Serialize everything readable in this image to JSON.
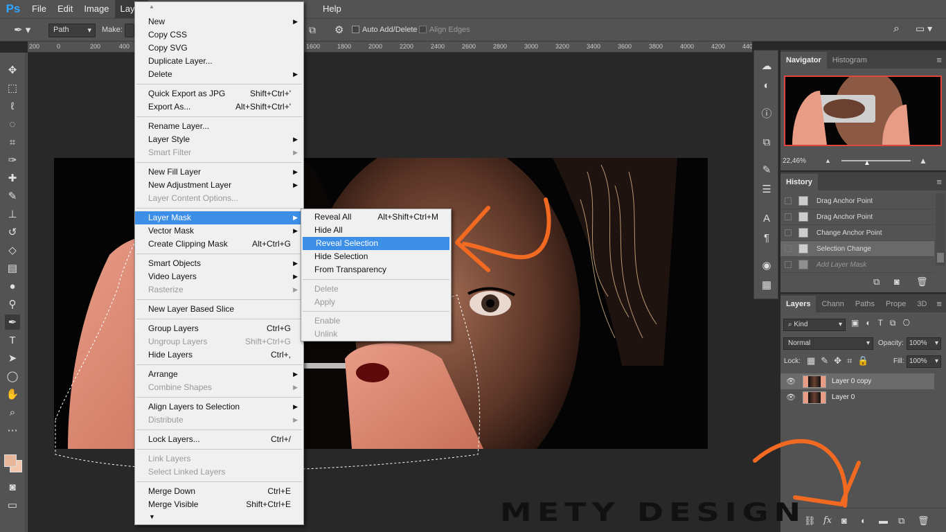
{
  "app": {
    "logo": "Ps"
  },
  "menubar": {
    "items": [
      {
        "label": "File"
      },
      {
        "label": "Edit"
      },
      {
        "label": "Image"
      },
      {
        "label": "Layer"
      },
      {
        "label": "Help"
      }
    ]
  },
  "options": {
    "mode": "Path",
    "make_label": "Make:",
    "auto_add_delete": "Auto Add/Delete",
    "align_edges": "Align Edges"
  },
  "ruler": {
    "ticks": [
      "200",
      "0",
      "200",
      "400",
      "1600",
      "1800",
      "2000",
      "2200",
      "2400",
      "2600",
      "2800",
      "3000",
      "3200",
      "3400",
      "3600",
      "3800",
      "4000",
      "4200",
      "440"
    ]
  },
  "toolbar": {
    "icons": [
      "move-icon",
      "marquee-icon",
      "lasso-icon",
      "quick-select-icon",
      "crop-icon",
      "eyedropper-icon",
      "healing-icon",
      "brush-icon",
      "stamp-icon",
      "history-brush-icon",
      "eraser-icon",
      "gradient-icon",
      "blur-icon",
      "dodge-icon",
      "pen-icon",
      "type-icon",
      "path-select-icon",
      "ellipse-icon",
      "hand-icon",
      "zoom-icon",
      "more-icon"
    ]
  },
  "layer_menu": {
    "items": [
      {
        "label": "New",
        "arrow": true
      },
      {
        "label": "Copy CSS"
      },
      {
        "label": "Copy SVG"
      },
      {
        "label": "Duplicate Layer..."
      },
      {
        "label": "Delete",
        "arrow": true
      },
      {
        "label": "Quick Export as JPG",
        "shortcut": "Shift+Ctrl+'"
      },
      {
        "label": "Export As...",
        "shortcut": "Alt+Shift+Ctrl+'"
      },
      {
        "label": "Rename Layer..."
      },
      {
        "label": "Layer Style",
        "arrow": true
      },
      {
        "label": "Smart Filter",
        "arrow": true,
        "disabled": true
      },
      {
        "label": "New Fill Layer",
        "arrow": true
      },
      {
        "label": "New Adjustment Layer",
        "arrow": true
      },
      {
        "label": "Layer Content Options...",
        "disabled": true
      },
      {
        "label": "Layer Mask",
        "arrow": true,
        "highlight": true
      },
      {
        "label": "Vector Mask",
        "arrow": true
      },
      {
        "label": "Create Clipping Mask",
        "shortcut": "Alt+Ctrl+G"
      },
      {
        "label": "Smart Objects",
        "arrow": true
      },
      {
        "label": "Video Layers",
        "arrow": true
      },
      {
        "label": "Rasterize",
        "arrow": true,
        "disabled": true
      },
      {
        "label": "New Layer Based Slice"
      },
      {
        "label": "Group Layers",
        "shortcut": "Ctrl+G"
      },
      {
        "label": "Ungroup Layers",
        "shortcut": "Shift+Ctrl+G",
        "disabled": true
      },
      {
        "label": "Hide Layers",
        "shortcut": "Ctrl+,"
      },
      {
        "label": "Arrange",
        "arrow": true
      },
      {
        "label": "Combine Shapes",
        "arrow": true,
        "disabled": true
      },
      {
        "label": "Align Layers to Selection",
        "arrow": true
      },
      {
        "label": "Distribute",
        "arrow": true,
        "disabled": true
      },
      {
        "label": "Lock Layers...",
        "shortcut": "Ctrl+/"
      },
      {
        "label": "Link Layers",
        "disabled": true
      },
      {
        "label": "Select Linked Layers",
        "disabled": true
      },
      {
        "label": "Merge Down",
        "shortcut": "Ctrl+E"
      },
      {
        "label": "Merge Visible",
        "shortcut": "Shift+Ctrl+E"
      }
    ]
  },
  "mask_submenu": {
    "items": [
      {
        "label": "Reveal All",
        "shortcut": "Alt+Shift+Ctrl+M"
      },
      {
        "label": "Hide All"
      },
      {
        "label": "Reveal Selection",
        "highlight": true
      },
      {
        "label": "Hide Selection"
      },
      {
        "label": "From Transparency"
      },
      {
        "label": "Delete",
        "disabled": true
      },
      {
        "label": "Apply",
        "disabled": true
      },
      {
        "label": "Enable",
        "disabled": true
      },
      {
        "label": "Unlink",
        "disabled": true
      }
    ]
  },
  "navigator": {
    "tabs": [
      "Navigator",
      "Histogram"
    ],
    "zoom": "22,46%"
  },
  "history": {
    "title": "History",
    "rows": [
      {
        "label": "Drag Anchor Point"
      },
      {
        "label": "Drag Anchor Point"
      },
      {
        "label": "Change Anchor Point"
      },
      {
        "label": "Selection Change",
        "selected": true
      },
      {
        "label": "Add Layer Mask",
        "dim": true
      }
    ]
  },
  "layers": {
    "tabs": [
      "Layers",
      "Chann",
      "Paths",
      "Prope",
      "3D"
    ],
    "kind": "Kind",
    "blend": "Normal",
    "opacity_label": "Opacity:",
    "opacity": "100%",
    "lock_label": "Lock:",
    "fill_label": "Fill:",
    "fill": "100%",
    "rows": [
      {
        "name": "Layer 0 copy",
        "selected": true
      },
      {
        "name": "Layer 0"
      }
    ]
  },
  "watermark": "METY DESIGN",
  "colors": {
    "accent": "#3d8ee6",
    "annotation": "#f26a21",
    "ps_blue": "#2fa6ff"
  }
}
